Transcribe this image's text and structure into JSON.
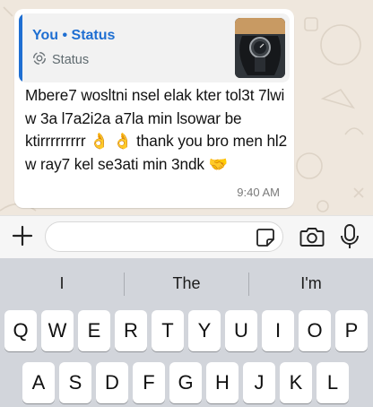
{
  "chat": {
    "quote": {
      "title": "You • Status",
      "subtitle": "Status",
      "accent_color": "#1f6fd2"
    },
    "message": {
      "text": "Mbere7 wosltni nsel elak kter tol3t 7lwi w 3a l7a2i2a a7la min lsowar be ktirrrrrrrrr 👌 👌 thank you bro men hl2 w ray7 kel se3ati min 3ndk 🤝",
      "time": "9:40 AM"
    }
  },
  "input_bar": {
    "placeholder": "",
    "icons": [
      "plus-icon",
      "sticker-icon",
      "camera-icon",
      "mic-icon"
    ]
  },
  "keyboard": {
    "suggestions": [
      "I",
      "The",
      "I'm"
    ],
    "row1": [
      "Q",
      "W",
      "E",
      "R",
      "T",
      "Y",
      "U",
      "I",
      "O",
      "P"
    ],
    "row2": [
      "A",
      "S",
      "D",
      "F",
      "G",
      "H",
      "J",
      "K",
      "L"
    ]
  }
}
